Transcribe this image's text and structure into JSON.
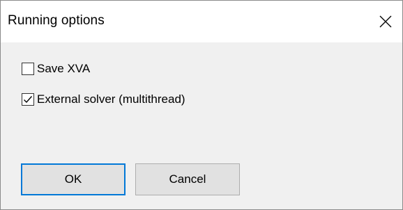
{
  "window": {
    "title": "Running options"
  },
  "icons": {
    "close": "close-icon",
    "checkmark": "checkmark-icon"
  },
  "options": {
    "save_xva": {
      "label": "Save XVA",
      "checked": false
    },
    "external_solver": {
      "label": "External solver (multithread)",
      "checked": true
    }
  },
  "buttons": {
    "ok_label": "OK",
    "cancel_label": "Cancel"
  },
  "colors": {
    "default_button_border": "#0078d7",
    "dialog_background": "#f0f0f0",
    "title_background": "#ffffff"
  }
}
